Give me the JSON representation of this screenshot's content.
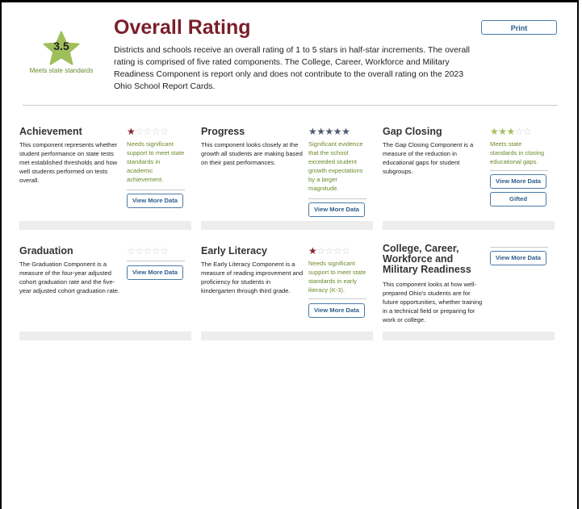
{
  "overall": {
    "rating_value": "3.5",
    "rating_label": "Meets state standards",
    "title": "Overall Rating",
    "description": "Districts and schools receive an overall rating of 1 to 5 stars in half-star increments. The overall rating is comprised of five rated components. The College, Career, Workforce and Military Readiness Component is report only and does not contribute to the overall rating on the 2023 Ohio School Report Cards.",
    "print_label": "Print",
    "badge_color": "#9fbf5a",
    "title_color": "#7a1f2b"
  },
  "components": [
    {
      "title": "Achievement",
      "description": "This component represents whether student performance on state tests met established thresholds and how well students performed on tests overall.",
      "stars": 1,
      "rating_text": "Needs significant support to meet state standards in academic achievement.",
      "buttons": [
        "View More Data"
      ]
    },
    {
      "title": "Progress",
      "description": "This component looks closely at the growth all students are making based on their past performances.",
      "stars": 5,
      "rating_text": "Significant evidence that the school exceeded student growth expectations by a larger magnitude.",
      "buttons": [
        "View More Data"
      ]
    },
    {
      "title": "Gap Closing",
      "description": "The Gap Closing Component is a measure of the reduction in educational gaps for student subgroups.",
      "stars": 3,
      "rating_text": "Meets state standards in closing educational gaps.",
      "buttons": [
        "View More Data",
        "Gifted"
      ]
    },
    {
      "title": "Graduation",
      "description": "The Graduation Component is a measure of the four-year adjusted cohort graduation rate and the five-year adjusted cohort graduation rate.",
      "stars": 0,
      "rating_text": "",
      "buttons": [
        "View More Data"
      ]
    },
    {
      "title": "Early Literacy",
      "description": "The Early Literacy Component is a measure of reading improvement and proficiency for students in kindergarten through third grade.",
      "stars": 1,
      "rating_text": "Needs significant support to meet state standards in early literacy (K-3).",
      "buttons": [
        "View More Data"
      ]
    },
    {
      "title": "College, Career, Workforce and Military Readiness",
      "description": "This component looks at how well-prepared Ohio's students are for future opportunities, whether training in a technical field or preparing for work or college.",
      "stars": null,
      "rating_text": "",
      "buttons": [
        "View More Data"
      ]
    }
  ],
  "icons": {
    "star": "star-icon"
  },
  "colors": {
    "star_red": "#8a2233",
    "star_blue": "#4f5b72",
    "star_green": "#a6bf5f",
    "star_empty": "#cfcfcf",
    "rating_text": "#6b8a2a",
    "button": "#2c5d8c"
  }
}
